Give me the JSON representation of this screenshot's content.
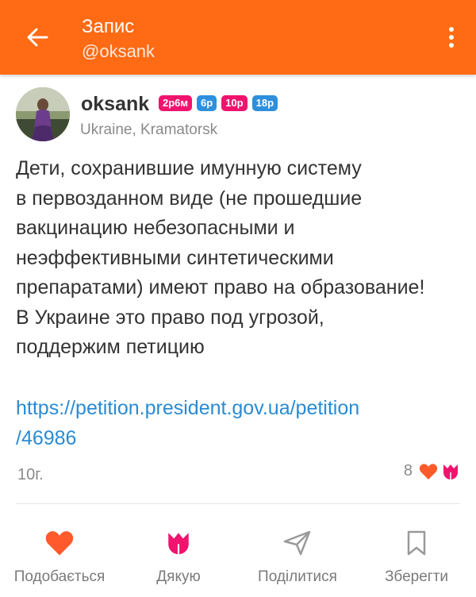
{
  "appbar": {
    "title": "Запис",
    "subtitle": "@oksank",
    "accent_color": "#ff6a14",
    "back_icon": "arrow-left-icon",
    "menu_icon": "more-vertical-icon"
  },
  "post": {
    "author": {
      "name": "oksank",
      "location": "Ukraine, Kramatorsk",
      "badges": [
        {
          "label": "2р6м",
          "color": "#f0146e"
        },
        {
          "label": "6р",
          "color": "#2e8fdc"
        },
        {
          "label": "10р",
          "color": "#f0146e"
        },
        {
          "label": "18р",
          "color": "#2e8fdc"
        }
      ]
    },
    "text_lines": [
      "Дети, сохранившие имунную систему",
      "в первозданном виде (не прошедшие",
      "вакцинацию небезопасными и",
      "неэффективными синтетическими",
      "препаратами) имеют право на образование!",
      "В Украине это право под угрозой,",
      "поддержим петицию"
    ],
    "link_lines": [
      "https://petition.president.gov.ua/petition",
      "/46986"
    ],
    "age": "10г.",
    "reaction_count": "8"
  },
  "actions": [
    {
      "label": "Подобається",
      "icon": "heart-icon",
      "color": "#ff5a2c"
    },
    {
      "label": "Дякую",
      "icon": "tulip-icon",
      "color": "#f0146e"
    },
    {
      "label": "Поділитися",
      "icon": "share-send-icon",
      "color": "#9a9a9a"
    },
    {
      "label": "Зберегти",
      "icon": "bookmark-icon",
      "color": "#9a9a9a"
    }
  ]
}
